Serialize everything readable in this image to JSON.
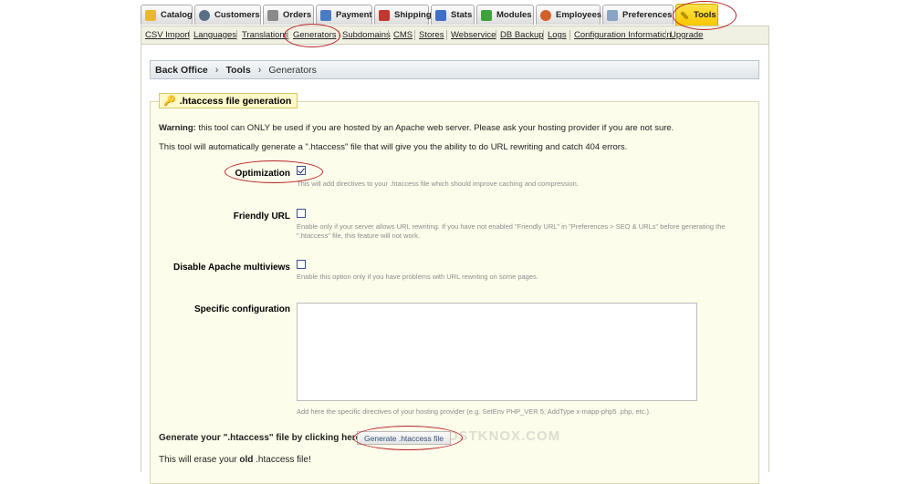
{
  "tabs": [
    {
      "label": "Catalog",
      "icon": "folder-icon",
      "color": "#e8b92c"
    },
    {
      "label": "Customers",
      "icon": "user-icon",
      "color": "#5a6f85"
    },
    {
      "label": "Orders",
      "icon": "cart-icon",
      "color": "#8a8a8a"
    },
    {
      "label": "Payment",
      "icon": "payment-icon",
      "color": "#4b7bc2"
    },
    {
      "label": "Shipping",
      "icon": "truck-icon",
      "color": "#c2372f"
    },
    {
      "label": "Stats",
      "icon": "stats-icon",
      "color": "#3f6fc6"
    },
    {
      "label": "Modules",
      "icon": "modules-icon",
      "color": "#3ea23a"
    },
    {
      "label": "Employees",
      "icon": "employees-icon",
      "color": "#d35f2b"
    },
    {
      "label": "Preferences",
      "icon": "preferences-icon",
      "color": "#8aa4c4"
    },
    {
      "label": "Tools",
      "icon": "tools-icon",
      "color": "#b99300",
      "active": true
    }
  ],
  "submenu": [
    "CSV Import",
    "Languages",
    "Translations",
    "Generators",
    "Subdomains",
    "CMS",
    "Stores",
    "Webservice",
    "DB Backup",
    "Logs",
    "Configuration Information",
    "Upgrade"
  ],
  "breadcrumb": {
    "root": "Back Office",
    "section": "Tools",
    "current": "Generators"
  },
  "legend": ".htaccess file generation",
  "warning": {
    "strong": "Warning:",
    "text": " this tool can ONLY be used if you are hosted by an Apache web server. Please ask your hosting provider if you are not sure."
  },
  "intro": "This tool will automatically generate a \".htaccess\" file that will give you the ability to do URL rewriting and catch 404 errors.",
  "options": [
    {
      "label": "Optimization",
      "checked": true,
      "hint": "This will add directives to your .htaccess file which should improve caching and compression."
    },
    {
      "label": "Friendly URL",
      "checked": false,
      "hint": "Enable only if your server allows URL rewriting. If you have not enabled \"Friendly URL\" in \"Preferences > SEO & URLs\" before generating the \".htaccess\" file, this feature will not work."
    },
    {
      "label": "Disable Apache multiviews",
      "checked": false,
      "hint": "Enable this option only if you have problems with URL rewriting on some pages."
    }
  ],
  "specific": {
    "label": "Specific configuration",
    "value": "",
    "hint": "Add here the specific directives of your hosting provider (e.g. SetEnv PHP_VER 5, AddType x-mapp-php5 .php, etc.)."
  },
  "generate": {
    "prompt": "Generate your \".htaccess\" file by clicking here:",
    "button": "Generate .htaccess file"
  },
  "erase": {
    "pre": "This will erase your ",
    "strong": "old",
    "post": " .htaccess file!"
  },
  "watermark": "HOSTKNOX.COM",
  "colors": {
    "annotation": "#b8232a",
    "active_tab": "#f7c800",
    "panel_bg": "#fdfdeb"
  }
}
